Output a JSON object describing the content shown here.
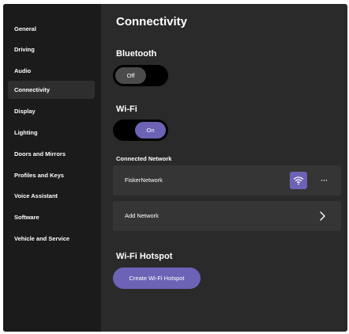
{
  "sidebar": {
    "items": [
      {
        "label": "General"
      },
      {
        "label": "Driving"
      },
      {
        "label": "Audio"
      },
      {
        "label": "Connectivity",
        "active": true
      },
      {
        "label": "Display"
      },
      {
        "label": "Lighting"
      },
      {
        "label": "Doors and Mirrors"
      },
      {
        "label": "Profiles and Keys"
      },
      {
        "label": "Voice Assistant"
      },
      {
        "label": "Software"
      },
      {
        "label": "Vehicle and Service"
      }
    ]
  },
  "main": {
    "title": "Connectivity",
    "bluetooth": {
      "title": "Bluetooth",
      "toggle_label": "Off",
      "state": "off"
    },
    "wifi": {
      "title": "Wi-Fi",
      "toggle_label": "On",
      "state": "on"
    },
    "connected_network": {
      "title": "Connected Network",
      "network_name": "FiskerNetwork",
      "more_label": "···"
    },
    "add_network": {
      "label": "Add Network"
    },
    "hotspot": {
      "title": "Wi-Fi Hotspot",
      "button_label": "Create Wi-Fi Hotspot"
    }
  },
  "colors": {
    "accent": "#6c63b6",
    "sidebar_bg": "#1b1b1b",
    "main_bg": "#2a2a2a",
    "row_bg": "#353535"
  },
  "icons": [
    "wifi-icon",
    "more-icon",
    "chevron-right-icon"
  ]
}
